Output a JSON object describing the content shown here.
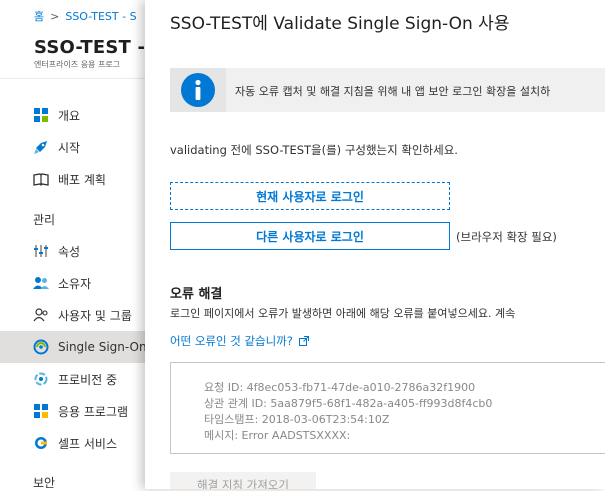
{
  "breadcrumb": [
    "홈",
    "SSO-TEST - S"
  ],
  "app": {
    "title": "SSO-TEST - SA",
    "subtitle": "엔터프라이즈 응용 프로그"
  },
  "nav": {
    "top_items": [
      {
        "label": "개요",
        "icon": "overview-grid-icon"
      },
      {
        "label": "시작",
        "icon": "rocket-icon"
      },
      {
        "label": "배포 계획",
        "icon": "book-icon"
      }
    ],
    "manage_header": "관리",
    "manage_items": [
      {
        "label": "속성",
        "icon": "properties-icon"
      },
      {
        "label": "소유자",
        "icon": "owners-icon"
      },
      {
        "label": "사용자 및 그룹",
        "icon": "users-groups-icon"
      },
      {
        "label": "Single Sign-On",
        "icon": "single-sign-on-icon"
      },
      {
        "label": "프로비전 중",
        "icon": "provisioning-icon"
      },
      {
        "label": "응용 프로그램",
        "icon": "application-icon"
      },
      {
        "label": "셀프 서비스",
        "icon": "self-service-icon"
      }
    ],
    "security_header": "보안",
    "active_item": "Single Sign-On"
  },
  "panel": {
    "title": "SSO-TEST에 Validate Single Sign-On 사용",
    "info_text": "자동 오류 캡처 및 해결 지침을 위해 내 앱 보안 로그인 확장을 설치하",
    "confirm_text": "validating 전에 SSO-TEST을(를) 구성했는지 확인하세요.",
    "login_current_button": "현재 사용자로 로그인",
    "login_other_button": "다른 사용자로 로그인",
    "browser_ext_note": "(브라우저 확장 필요)",
    "troubleshoot_title": "오류 해결",
    "troubleshoot_desc": "로그인 페이지에서 오류가 발생하면 아래에 해당 오류를 붙여넣으세요. 계속",
    "what_error_link": "어떤 오류인 것 같습니까?",
    "error_lines": [
      "요청 ID: 4f8ec053-fb71-47de-a010-2786a32f1900",
      "상관 관계 ID: 5aa879f5-68f1-482a-a405-ff993d8f4cb0",
      "타임스탬프: 2018-03-06T23:54:10Z",
      "메시지: Error AADSTSXXXX:"
    ],
    "fetch_button": "해결 지침 가져오기"
  },
  "colors": {
    "accent": "#0078d4",
    "active_nav": "#e1dfdd",
    "info_bg": "#f0f0f0"
  }
}
